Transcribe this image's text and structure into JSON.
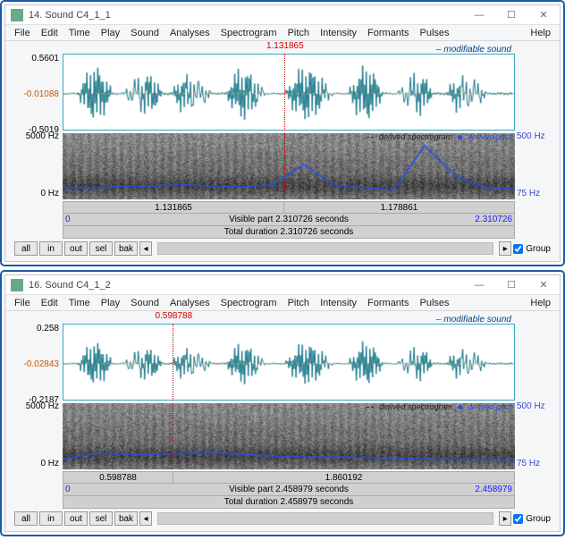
{
  "windows": [
    {
      "title": "14. Sound C4_1_1",
      "menu": [
        "File",
        "Edit",
        "Time",
        "Play",
        "Sound",
        "Analyses",
        "Spectrogram",
        "Pitch",
        "Intensity",
        "Formants",
        "Pulses"
      ],
      "help_label": "Help",
      "wave_ymax": "0.5601",
      "wave_ymid": "-0.01088",
      "wave_ymin": "-0.5019",
      "cursor_time": "1.131865",
      "cursor_frac": 0.49,
      "legend_wave": "– modifiable sound",
      "spec_high": "5000 Hz",
      "spec_low": "0 Hz",
      "pitch_high": "500 Hz",
      "pitch_low": "75 Hz",
      "spec_legend_spec": "derived spectrogram",
      "spec_legend_pitch": "derived pitch",
      "timebar_left": "1.131865",
      "timebar_right": "1.178861",
      "vis_left": "0",
      "vis_text": "Visible part 2.310726 seconds",
      "vis_right": "2.310726",
      "total_text": "Total duration 2.310726 seconds",
      "buttons": [
        "all",
        "in",
        "out",
        "sel",
        "bak"
      ],
      "group_label": "Group"
    },
    {
      "title": "16. Sound C4_1_2",
      "menu": [
        "File",
        "Edit",
        "Time",
        "Play",
        "Sound",
        "Analyses",
        "Spectrogram",
        "Pitch",
        "Intensity",
        "Formants",
        "Pulses"
      ],
      "help_label": "Help",
      "wave_ymax": "0.258",
      "wave_ymid": "-0.02843",
      "wave_ymin": "-0.2187",
      "cursor_time": "0.598788",
      "cursor_frac": 0.244,
      "legend_wave": "– modifiable sound",
      "spec_high": "5000 Hz",
      "spec_low": "0 Hz",
      "pitch_high": "500 Hz",
      "pitch_low": "75 Hz",
      "spec_legend_spec": "derived spectrogram",
      "spec_legend_pitch": "derived pitch",
      "timebar_left": "0.598788",
      "timebar_right": "1.860192",
      "vis_left": "0",
      "vis_text": "Visible part 2.458979 seconds",
      "vis_right": "2.458979",
      "total_text": "Total duration 2.458979 seconds",
      "buttons": [
        "all",
        "in",
        "out",
        "sel",
        "bak"
      ],
      "group_label": "Group"
    }
  ],
  "win_min": "—",
  "win_max": "☐",
  "win_close": "✕",
  "colors": {
    "wave": "#1e7a8c",
    "pitch": "#2a4ce0",
    "cursor": "#c00000",
    "yorange": "#c05a00"
  },
  "chart_data": [
    {
      "type": "waveform+spectrogram",
      "title": "Sound C4_1_1",
      "time_range_s": [
        0,
        2.310726
      ],
      "cursor_s": 1.131865,
      "amplitude_range": [
        -0.5019,
        0.5601
      ],
      "amplitude_center": -0.01088,
      "spectrogram_hz_range": [
        0,
        5000
      ],
      "pitch_hz_range": [
        75,
        500
      ],
      "pitch_track_hz_est": [
        150,
        150,
        160,
        160,
        170,
        160,
        155,
        170,
        300,
        165,
        150,
        140,
        420,
        230,
        150,
        145
      ]
    },
    {
      "type": "waveform+spectrogram",
      "title": "Sound C4_1_2",
      "time_range_s": [
        0,
        2.458979
      ],
      "cursor_s": 0.598788,
      "amplitude_range": [
        -0.2187,
        0.258
      ],
      "amplitude_center": -0.02843,
      "spectrogram_hz_range": [
        0,
        5000
      ],
      "pitch_hz_range": [
        75,
        500
      ],
      "pitch_track_hz_est": [
        140,
        180,
        170,
        175,
        180,
        175,
        160,
        155,
        155,
        150,
        145,
        140,
        140,
        135
      ]
    }
  ]
}
